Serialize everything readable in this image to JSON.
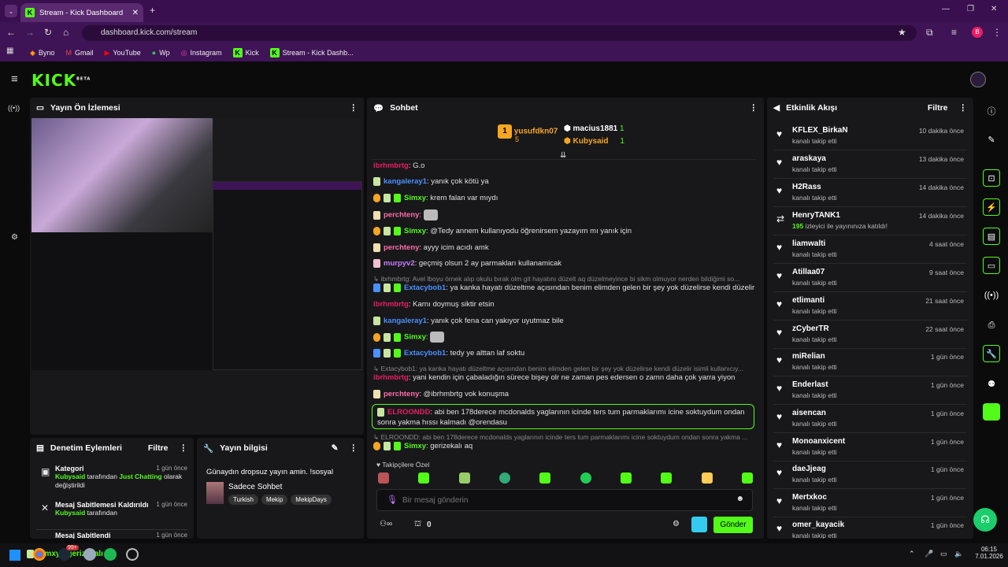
{
  "browser": {
    "tab_title": "Stream - Kick Dashboard",
    "url": "dashboard.kick.com/stream",
    "bookmarks": [
      "Byno",
      "Gmail",
      "YouTube",
      "Wp",
      "Instagram",
      "Kick",
      "Stream - Kick Dashb..."
    ],
    "profile": "B"
  },
  "app": {
    "logo": "KICK",
    "beta": "BETA"
  },
  "preview": {
    "title": "Yayın Ön İzlemesi"
  },
  "moderation": {
    "title": "Denetim Eylemleri",
    "filter": "Filtre",
    "items": [
      {
        "title": "Kategori",
        "time": "1 gün önce",
        "user": "Kubysaid",
        "text1": "tarafından",
        "cat": "Just Chatting",
        "text2": "olarak değiştirildi"
      },
      {
        "title": "Mesaj Sabitlemesi Kaldırıldı",
        "time": "1 gün önce",
        "user": "Kubysaid",
        "text1": "tarafından"
      },
      {
        "title": "Mesaj Sabitlendi",
        "time": "1 gün önce"
      }
    ]
  },
  "streaminfo": {
    "title": "Yayın bilgisi",
    "stream_title": "Günaydın dropsuz yayın amin. !sosyal",
    "category": "Sadece Sohbet",
    "tags": [
      "Turkish",
      "Mekip",
      "MekipDays"
    ]
  },
  "chat": {
    "title": "Sohbet",
    "top": [
      {
        "rank": "1",
        "name": "yusufdkn07",
        "count": "5"
      },
      {
        "name": "macius1881",
        "count": "1"
      },
      {
        "name": "Kubysaid",
        "count": "1"
      }
    ],
    "messages": [
      {
        "user": "ibrhmbrtg",
        "color": "#e91e63",
        "text": ": G.o"
      },
      {
        "user": "kangaleray1",
        "color": "#4a90ff",
        "text": ": yanık çok kötü ya"
      },
      {
        "user": "Simxy",
        "color": "#53fc18",
        "text": ": krem falan var mıydı"
      },
      {
        "user": "perchteny",
        "color": "#ff6fa8",
        "text": ":"
      },
      {
        "user": "Simxy",
        "color": "#53fc18",
        "text": ": @Tedy annem kullanıyodu öğrenirsem yazayım mı yanık için"
      },
      {
        "user": "perchteny",
        "color": "#ff6fa8",
        "text": ": ayyy icim acıdı amk"
      },
      {
        "user": "murpyv2",
        "color": "#c77dff",
        "text": ": geçmiş olsun 2 ay parmakları kullanamicak"
      },
      {
        "reply": "ibrhmbrtg: Avel lboyu örnek alıp okulu bırak olm git hayatını düzelt aq düzelmeyince bi sikm olmuyor nerden bildiğimi so..."
      },
      {
        "user": "Extacybob1",
        "color": "#4a90ff",
        "text": ": ya kanka hayatı düzeltme açısından benim elimden gelen bir şey yok düzelirse kendi düzelir"
      },
      {
        "user": "ibrhmbrtg",
        "color": "#e91e63",
        "text": ": Karnı doymuş siktir etsin"
      },
      {
        "user": "kangaleray1",
        "color": "#4a90ff",
        "text": ": yanık çok fena can yakıyor uyutmaz bile"
      },
      {
        "user": "Simxy",
        "color": "#53fc18",
        "text": ":"
      },
      {
        "user": "Extacybob1",
        "color": "#4a90ff",
        "text": ": tedy ye alttan laf soktu"
      },
      {
        "reply": "Extacybob1: ya kanka hayatı düzeltme açısından benim elimden gelen bir şey yok düzelirse kendi düzelir isimli kullanıcıy..."
      },
      {
        "user": "ibrhmbrtg",
        "color": "#e91e63",
        "text": ": yani kendin için çabaladığın sürece bişey olr ne zaman pes edersen o zamn daha çok yarra yiyon"
      },
      {
        "user": "perchteny",
        "color": "#ff6fa8",
        "text": ": @ibrhmbrtg vok konuşma"
      },
      {
        "user": "ELROONDD",
        "color": "#e91e63",
        "text": ": abi ben 178derece mcdonalds yaglarının icinde ters tum parmaklarımı icine soktuydum ondan sonra yakma hıssı kalmadı @orendasu"
      },
      {
        "reply": "ELROONDD: abi ben 178derece mcdonalds yaglarının icinde ters tum parmaklarımı icine soktuydum ondan sonra yakma ..."
      },
      {
        "user": "Simxy",
        "color": "#53fc18",
        "text": ": gerizekalı aq"
      }
    ],
    "emote_section": "Takipçilere Özel",
    "input_placeholder": "Bir mesaj gönderin",
    "send": "Gönder",
    "points": "0"
  },
  "activity": {
    "title": "Etkinlik Akışı",
    "filter": "Filtre",
    "items": [
      {
        "name": "KFLEX_BirkaN",
        "sub": "kanalı takip etti",
        "time": "10 dakika önce"
      },
      {
        "name": "araskaya",
        "sub": "kanalı takip etti",
        "time": "13 dakika önce"
      },
      {
        "name": "H2Rass",
        "sub": "kanalı takip etti",
        "time": "14 dakika önce"
      },
      {
        "name": "HenryTANK1",
        "sub_num": "195",
        "sub": "izleyici ile yayınınıza katıldı!",
        "time": "14 dakika önce"
      },
      {
        "name": "liamwalti",
        "sub": "kanalı takip etti",
        "time": "4 saat önce"
      },
      {
        "name": "Atillaa07",
        "sub": "kanalı takip etti",
        "time": "9 saat önce"
      },
      {
        "name": "etlimanti",
        "sub": "kanalı takip etti",
        "time": "21 saat önce"
      },
      {
        "name": "zCyberTR",
        "sub": "kanalı takip etti",
        "time": "22 saat önce"
      },
      {
        "name": "miRelian",
        "sub": "kanalı takip etti",
        "time": "1 gün önce"
      },
      {
        "name": "Enderlast",
        "sub": "kanalı takip etti",
        "time": "1 gün önce"
      },
      {
        "name": "aisencan",
        "sub": "kanalı takip etti",
        "time": "1 gün önce"
      },
      {
        "name": "Monoanxicent",
        "sub": "kanalı takip etti",
        "time": "1 gün önce"
      },
      {
        "name": "daeJjeag",
        "sub": "kanalı takip etti",
        "time": "1 gün önce"
      },
      {
        "name": "Mertxkoc",
        "sub": "kanalı takip etti",
        "time": "1 gün önce"
      },
      {
        "name": "omer_kayacik",
        "sub": "kanalı takip etti",
        "time": "1 gün önce"
      }
    ]
  },
  "taskbar": {
    "notice": "Simxy : gerizekalı aq",
    "time": "06:15",
    "date": "7.01.2026",
    "badge": "99+"
  },
  "colors": {
    "accent": "#53fc18",
    "bg": "#0b0b0c",
    "panel": "#18181b"
  }
}
